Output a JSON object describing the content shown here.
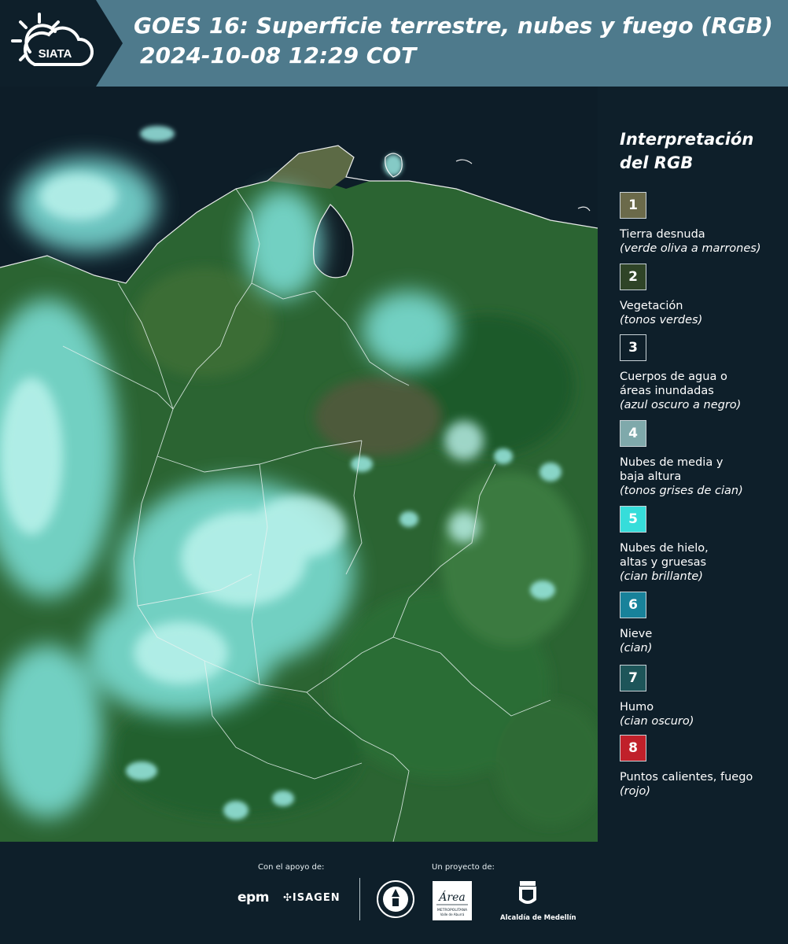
{
  "header": {
    "logo_text": "SIATA",
    "title_line1": "GOES 16: Superficie terrestre, nubes y fuego (RGB)",
    "title_line2": "2024-10-08 12:29 COT"
  },
  "legend": {
    "title_line1": "Interpretación",
    "title_line2": "del RGB",
    "items": [
      {
        "number": "1",
        "label": "Tierra desnuda",
        "desc": "(verde oliva a marrones)",
        "color": "#6b6a4a"
      },
      {
        "number": "2",
        "label": "Vegetación",
        "desc": "(tonos verdes)",
        "color": "#2f4427"
      },
      {
        "number": "3",
        "label": "Cuerpos de agua o\náreas inundadas",
        "desc": "(azul oscuro a negro)",
        "color": "#0e1f2a"
      },
      {
        "number": "4",
        "label": "Nubes de media y\nbaja altura",
        "desc": "(tonos grises de cian)",
        "color": "#7fa9ab"
      },
      {
        "number": "5",
        "label": "Nubes de hielo,\naltas y gruesas",
        "desc": "(cian brillante)",
        "color": "#36ddda"
      },
      {
        "number": "6",
        "label": "Nieve",
        "desc": "(cian)",
        "color": "#18829a"
      },
      {
        "number": "7",
        "label": "Humo",
        "desc": "(cian oscuro)",
        "color": "#1d5559"
      },
      {
        "number": "8",
        "label": "Puntos calientes, fuego",
        "desc": "(rojo)",
        "color": "#c0202a"
      }
    ]
  },
  "footer": {
    "support_label": "Con el apoyo de:",
    "project_label": "Un proyecto de:",
    "epm": "epm",
    "isagen": "ISAGEN",
    "amva_name": "Área",
    "amva_sub": "METROPOLITANA",
    "amva_sub2": "Valle de Aburrá",
    "alcaldia": "Alcaldía de Medellín"
  },
  "colors": {
    "header_bg": "#4e7a8c",
    "page_bg": "#0e1f2a",
    "vegetation": "#2e6a34",
    "cloud": "#7fe3dc",
    "ocean": "#0d1d28"
  }
}
